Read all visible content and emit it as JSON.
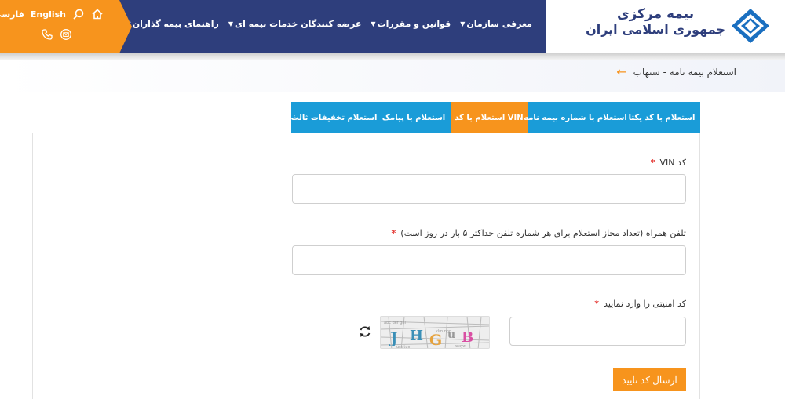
{
  "header": {
    "lang_farsi": "فارسی",
    "lang_english": "English",
    "menu": [
      {
        "label": "معرفی سازمان",
        "chevron": true
      },
      {
        "label": "قوانین و مقررات",
        "chevron": true
      },
      {
        "label": "عرضه کنندگان خدمات بیمه ای",
        "chevron": true
      },
      {
        "label": "راهنمای بیمه گذاران",
        "chevron": true
      }
    ],
    "logo_line1": "بیمه مرکزی",
    "logo_line2": "جمهوری اسلامی ایران"
  },
  "breadcrumb": {
    "title": "استعلام بیمه نامه - سنهاب",
    "arrow": "←"
  },
  "tabs": [
    {
      "label": "استعلام با کد یکتا",
      "active": false
    },
    {
      "label": "استعلام با شماره بیمه نامه",
      "active": false
    },
    {
      "label": "استعلام با کد VIN",
      "active": true
    },
    {
      "label": "استعلام با پیامک",
      "active": false
    },
    {
      "label": "استعلام تخفیفات ثالث",
      "active": false
    }
  ],
  "form": {
    "vin_label": "کد VIN",
    "phone_label": "تلفن همراه (تعداد مجاز استعلام برای هر شماره تلفن حداکثر ۵ بار در روز است)",
    "captcha_label": "کد امنیتی را وارد نمایید",
    "required_mark": "*",
    "vin_value": "",
    "phone_value": "",
    "captcha_value": "",
    "captcha_text": "J H G B B",
    "submit_label": "ارسال کد تایید"
  },
  "colors": {
    "orange": "#f7941d",
    "navy": "#2e3e7c",
    "tab_blue": "#1a9cd8"
  },
  "icons": [
    "home-icon",
    "search-icon",
    "phone-icon",
    "mail-icon",
    "refresh-icon"
  ]
}
